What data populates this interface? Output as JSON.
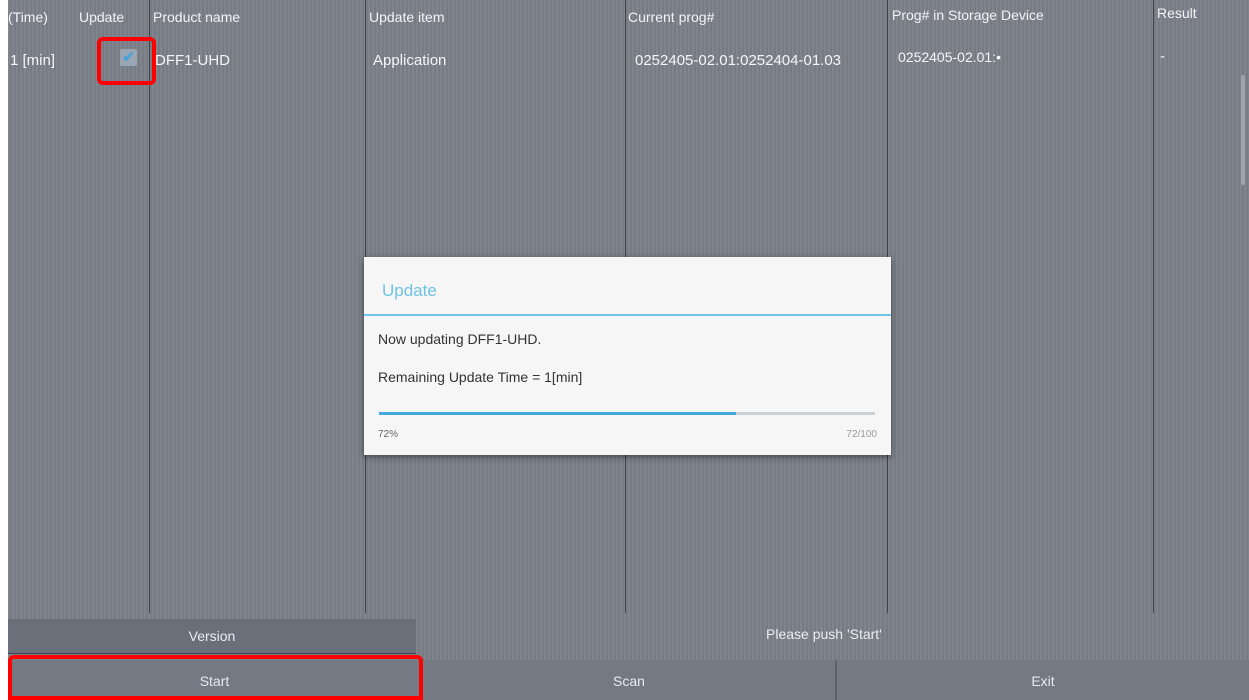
{
  "table": {
    "headers": [
      "(Time)",
      "Update",
      "Product name",
      "Update item",
      "Current prog#",
      "Prog# in Storage Device",
      "Result"
    ],
    "rows": [
      {
        "time": "1 [min]",
        "update_checked": true,
        "product_name": "DFF1-UHD",
        "update_item": "Application",
        "current_prog": "0252405-02.01:0252404-01.03",
        "storage_prog": "0252405-02.01:•",
        "result": "-"
      }
    ]
  },
  "dialog": {
    "title": "Update",
    "message": "Now updating DFF1-UHD.",
    "remaining": "Remaining Update Time = 1[min]",
    "progress_percent_label": "72%",
    "progress_count_label": "72/100",
    "progress_fraction": 0.72
  },
  "footer": {
    "version_label": "Version",
    "status_text": "Please push 'Start'",
    "start_label": "Start",
    "scan_label": "Scan",
    "exit_label": "Exit"
  },
  "colors": {
    "accent": "#43a8dd",
    "highlight": "#ff0000",
    "background": "#7b8089"
  }
}
